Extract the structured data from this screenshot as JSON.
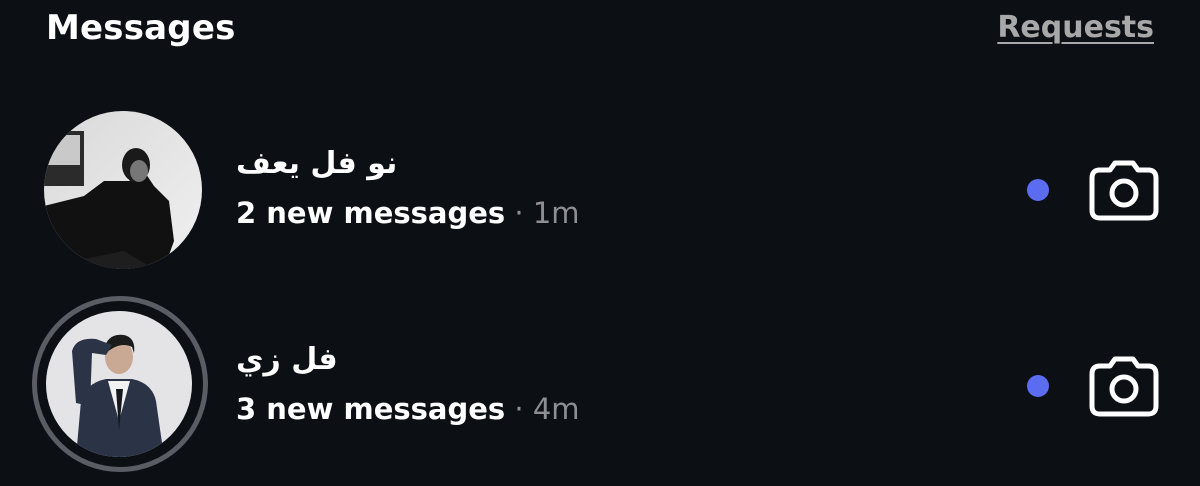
{
  "header": {
    "title": "Messages",
    "requests_label": "Requests"
  },
  "threads": [
    {
      "name": "نو فل يعف",
      "preview": "2 new messages",
      "separator": " · ",
      "time": "1m",
      "unread": true,
      "avatar": "profile-photo-grayscale-sitting"
    },
    {
      "name": "فل زي",
      "preview": "3 new messages",
      "separator": " · ",
      "time": "4m",
      "unread": true,
      "avatar": "profile-photo-suit-hand-on-head"
    }
  ],
  "colors": {
    "background": "#0c0f14",
    "unread_dot": "#5b6cf0",
    "muted_text": "#8d8f94",
    "story_ring": "#5a5d63"
  },
  "icons": {
    "camera": "camera-icon"
  }
}
